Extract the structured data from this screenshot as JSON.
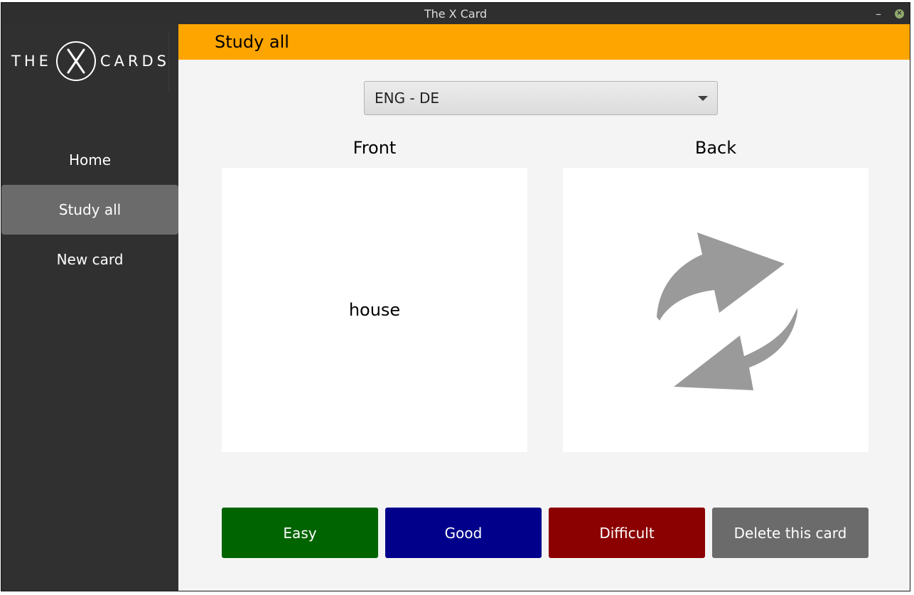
{
  "window": {
    "title": "The X Card"
  },
  "logo": {
    "left_text": "THE",
    "right_text": "CARDS",
    "icon": "x-logo-icon"
  },
  "sidebar": {
    "items": [
      {
        "label": "Home",
        "active": false
      },
      {
        "label": "Study all",
        "active": true
      },
      {
        "label": "New card",
        "active": false
      }
    ]
  },
  "header": {
    "title": "Study all"
  },
  "deck_select": {
    "value": "ENG - DE"
  },
  "front": {
    "label": "Front",
    "text": "house"
  },
  "back": {
    "label": "Back",
    "icon": "refresh-arrows-icon"
  },
  "buttons": {
    "easy": {
      "label": "Easy",
      "color": "#006400"
    },
    "good": {
      "label": "Good",
      "color": "#00008b"
    },
    "difficult": {
      "label": "Difficult",
      "color": "#8b0000"
    },
    "delete": {
      "label": "Delete this card",
      "color": "#6b6b6b"
    }
  },
  "colors": {
    "accent": "#ffa500",
    "sidebar": "#303030",
    "content": "#f4f4f4"
  }
}
